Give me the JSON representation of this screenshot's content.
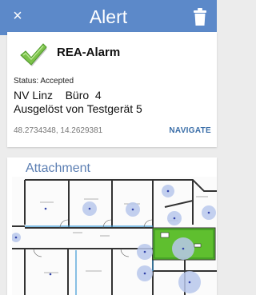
{
  "appbar": {
    "title": "Alert",
    "close_symbol": "×",
    "close_icon": "close-icon",
    "delete_icon": "trash-icon",
    "color": "#5c89c9"
  },
  "alarm": {
    "icon": "checkmark-icon",
    "title": "REA-Alarm",
    "status": "Status: Accepted",
    "location_line1": "NV Linz    Büro  4",
    "location_line2": "Ausgelöst von Testgerät 5",
    "coordinates": "48.2734348, 14.2629381",
    "navigate_label": "NAVIGATE"
  },
  "attachment": {
    "title": "Attachment",
    "image": "floor-plan"
  }
}
